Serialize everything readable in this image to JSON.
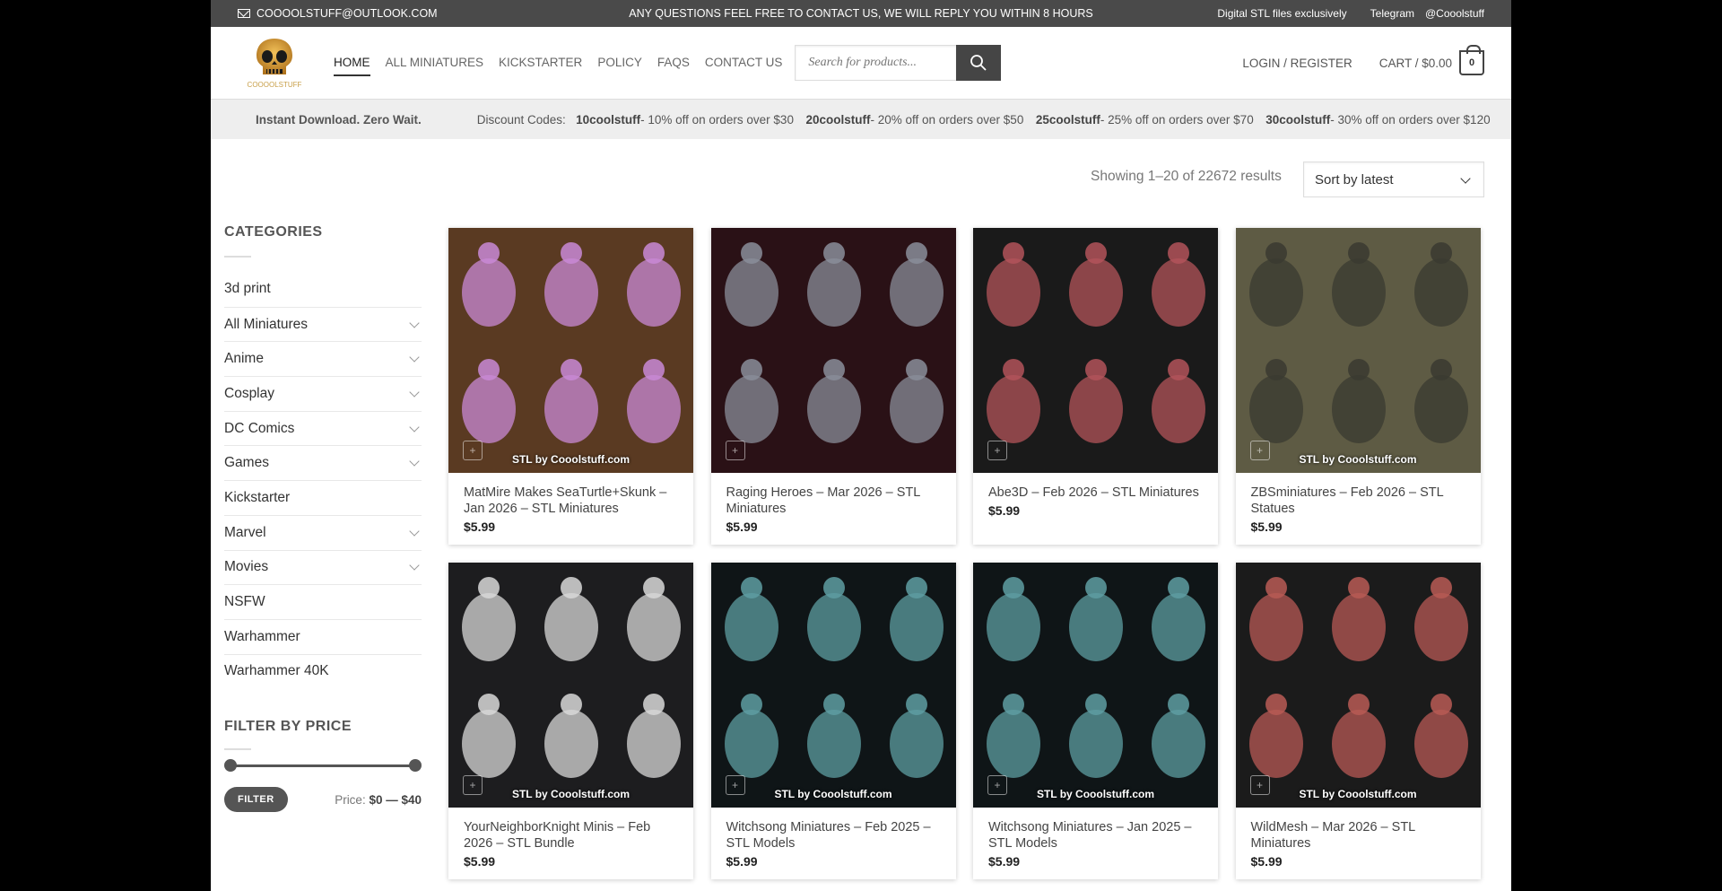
{
  "topbar": {
    "email": "COOOOLSTUFF@OUTLOOK.COM",
    "notice": "ANY QUESTIONS FEEL FREE TO CONTACT US, WE WILL REPLY YOU WITHIN 8 HOURS",
    "right1": "Digital STL files exclusively",
    "right2": "Telegram @Cooolstuff"
  },
  "logo": {
    "text": "COOOOLSTUFF"
  },
  "nav": {
    "home": "HOME",
    "all": "ALL MINIATURES",
    "kick": "KICKSTARTER",
    "policy": "POLICY",
    "faqs": "FAQS",
    "contact": "CONTACT US"
  },
  "search": {
    "placeholder": "Search for products..."
  },
  "header": {
    "login": "LOGIN / REGISTER",
    "cart": "CART / $0.00",
    "cart_count": "0"
  },
  "discount": {
    "instant": "Instant Download. Zero Wait.",
    "label": "Discount Codes:",
    "c1": "10coolstuff",
    "d1": " - 10% off on orders over $30 ",
    "c2": "20coolstuff",
    "d2": " - 20% off on orders over $50 ",
    "c3": "25coolstuff",
    "d3": " - 25% off on orders over $70 ",
    "c4": "30coolstuff",
    "d4": " - 30% off on orders over $120"
  },
  "shop": {
    "results": "Showing 1–20 of 22672 results",
    "sort": "Sort by latest"
  },
  "sidebar": {
    "categories_title": "CATEGORIES",
    "categories": [
      {
        "label": "3d print",
        "expand": false
      },
      {
        "label": "All Miniatures",
        "expand": true
      },
      {
        "label": "Anime",
        "expand": true
      },
      {
        "label": "Cosplay",
        "expand": true
      },
      {
        "label": "DC Comics",
        "expand": true
      },
      {
        "label": "Games",
        "expand": true
      },
      {
        "label": "Kickstarter",
        "expand": false
      },
      {
        "label": "Marvel",
        "expand": true
      },
      {
        "label": "Movies",
        "expand": true
      },
      {
        "label": "NSFW",
        "expand": false
      },
      {
        "label": "Warhammer",
        "expand": false
      },
      {
        "label": "Warhammer 40K",
        "expand": false
      }
    ],
    "price_title": "FILTER BY PRICE",
    "filter_btn": "FILTER",
    "price_label": "Price: ",
    "price_range": "$0 — $40"
  },
  "products": [
    {
      "title": "MatMire Makes SeaTurtle+Skunk – Jan 2026 – STL Miniatures",
      "price": "$5.99",
      "bg": "#5a3a22",
      "accent": "#c98ad6",
      "watermark": "STL by Cooolstuff.com"
    },
    {
      "title": "Raging Heroes – Mar 2026 – STL Miniatures",
      "price": "$5.99",
      "bg": "#2a1116",
      "accent": "#8a8e9a",
      "watermark": ""
    },
    {
      "title": "Abe3D – Feb 2026 – STL Miniatures",
      "price": "$5.99",
      "bg": "#1a1a1a",
      "accent": "#b3545a",
      "watermark": ""
    },
    {
      "title": "ZBSminiatures – Feb 2026 – STL Statues",
      "price": "$5.99",
      "bg": "#5e5b44",
      "accent": "#3a3a30",
      "watermark": "STL by Cooolstuff.com"
    },
    {
      "title": "YourNeighborKnight Minis – Feb 2026 – STL Bundle",
      "price": "$5.99",
      "bg": "#1d1d1f",
      "accent": "#d8d8d8",
      "watermark": "STL by Cooolstuff.com"
    },
    {
      "title": "Witchsong Miniatures – Feb 2025 – STL Models",
      "price": "$5.99",
      "bg": "#0f1517",
      "accent": "#5e9ea2",
      "watermark": "STL by Cooolstuff.com"
    },
    {
      "title": "Witchsong Miniatures – Jan 2025 – STL Models",
      "price": "$5.99",
      "bg": "#0f1517",
      "accent": "#5e9ea2",
      "watermark": "STL by Cooolstuff.com"
    },
    {
      "title": "WildMesh – Mar 2026 – STL Miniatures",
      "price": "$5.99",
      "bg": "#1b1b1b",
      "accent": "#b85a55",
      "watermark": "STL by Cooolstuff.com"
    }
  ],
  "colors": {
    "topbar": "#4a4a4a",
    "discount_bar": "#eeeeee",
    "accent": "#555555"
  }
}
